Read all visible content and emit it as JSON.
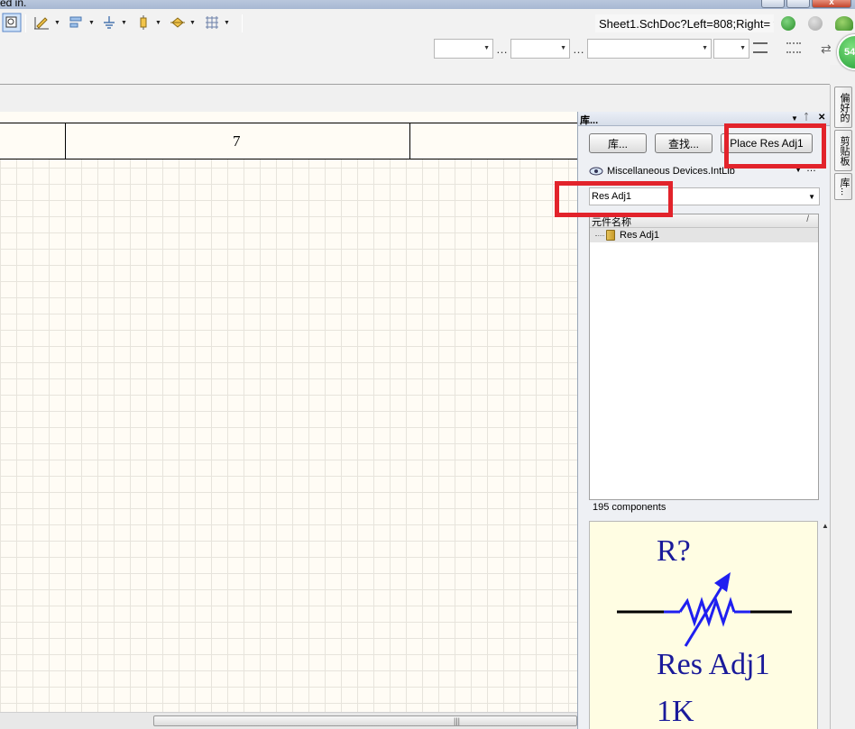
{
  "window": {
    "title_fragment": "ed in.",
    "close_label": "x"
  },
  "navigation": {
    "address": "Sheet1.SchDoc?Left=808;Right=",
    "badge": "54"
  },
  "sheet": {
    "zone_number": "7",
    "scroll_grip": "|||"
  },
  "library_panel": {
    "title": "库...",
    "pin_glyph": "ᛏ",
    "buttons": {
      "library": "库...",
      "search": "查找...",
      "place": "Place Res Adj1"
    },
    "selected_library": "Miscellaneous Devices.IntLib",
    "filter_text": "Res Adj1",
    "list_header": "元件名称",
    "components": [
      {
        "name": "Res Adj1"
      }
    ],
    "component_count": "195 components",
    "preview": {
      "designator": "R?",
      "comment": "Res Adj1",
      "value": "1K"
    }
  },
  "dock_tabs": [
    "偏好的",
    "剪贴板",
    "库..."
  ],
  "colors": {
    "highlight": "#e2232b",
    "symbol_blue": "#1f1ff0",
    "symbol_text": "#1a1a9a",
    "sheet_bg": "#fffcf5"
  }
}
